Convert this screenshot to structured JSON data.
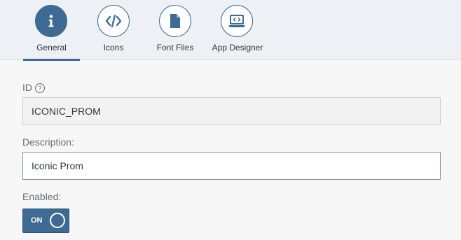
{
  "tabs": [
    {
      "label": "General",
      "icon": "info-icon",
      "active": true
    },
    {
      "label": "Icons",
      "icon": "code-icon",
      "active": false
    },
    {
      "label": "Font Files",
      "icon": "document-icon",
      "active": false
    },
    {
      "label": "App Designer",
      "icon": "laptop-code-icon",
      "active": false
    }
  ],
  "form": {
    "id_label": "ID",
    "id_value": "ICONIC_PROM",
    "description_label": "Description:",
    "description_value": "Iconic Prom",
    "enabled_label": "Enabled:",
    "enabled_state": "ON"
  },
  "colors": {
    "accent": "#3e6b94",
    "header_bg": "#edf1f5",
    "page_bg": "#f7f7f7"
  }
}
